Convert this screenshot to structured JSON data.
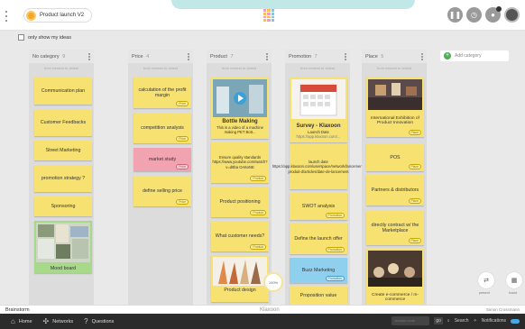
{
  "board": {
    "title": "Product launch V2"
  },
  "filter": {
    "only_my_ideas": "only show my ideas"
  },
  "columns": [
    {
      "name": "No category",
      "count": "9",
      "sub": "from newest to oldest"
    },
    {
      "name": "Price",
      "count": "4",
      "sub": "from newest to oldest"
    },
    {
      "name": "Product",
      "count": "7",
      "sub": "from newest to oldest"
    },
    {
      "name": "Promotion",
      "count": "7",
      "sub": "from newest to oldest"
    },
    {
      "name": "Place",
      "count": "5",
      "sub": "from newest to oldest"
    }
  ],
  "notes": {
    "c1": [
      "Communication plan",
      "Customer Feedbacks",
      "Street Marketing",
      "promotion strategy ?",
      "Sponsoring",
      "Mood board"
    ],
    "c2": [
      "calculation of the profit margin",
      "competition analysis",
      "market study",
      "define selling price"
    ],
    "c3": {
      "bottle_title": "Bottle Making",
      "bottle_sub": "This is a video of a machine making PET Bott...",
      "quality": "Ensure quality standards https://www.youtube.com/watch?v=d8ba OA6oNE",
      "positioning": "Product positioning",
      "needs": "What customer needs?",
      "design": "Product design"
    },
    "c4": {
      "survey_title": "Survey - Klaxoon",
      "survey_sub": "Launch Date",
      "survey_url": "https://app.klaxoon.com/...",
      "launch": "launch date https://app.klaxoon.com/userspace/network/lancement-produit-d/articles/date-de-lancement",
      "swot": "SWOT analysis",
      "define_launch": "Define the launch offer",
      "buzz": "Buzz Marketing",
      "prop": "Proposition value"
    },
    "c5": {
      "exhibition": "International Exhibition of Product Innovation",
      "pos": "POS",
      "partners": "Partners & distributors",
      "contract": "directly contract w/ the Marketplace",
      "ecommerce": "Create e-commerce / m-commerce"
    }
  },
  "tags": {
    "price": "Price",
    "product": "Product",
    "promotion": "Promotion",
    "place": "Place"
  },
  "add_category": "Add category",
  "side_tools": {
    "t1": "present",
    "t2": "board"
  },
  "zoom": "100%",
  "bottom_strip": {
    "left": "Brainstorm",
    "center": "Klaxoon",
    "right": "Simon Crossmann"
  },
  "bottom_bar": {
    "home": "Home",
    "networks": "Networks",
    "questions": "Questions",
    "search_placeholder": "Access code",
    "go": "go",
    "search": "Search",
    "notifications": "Notifications"
  }
}
